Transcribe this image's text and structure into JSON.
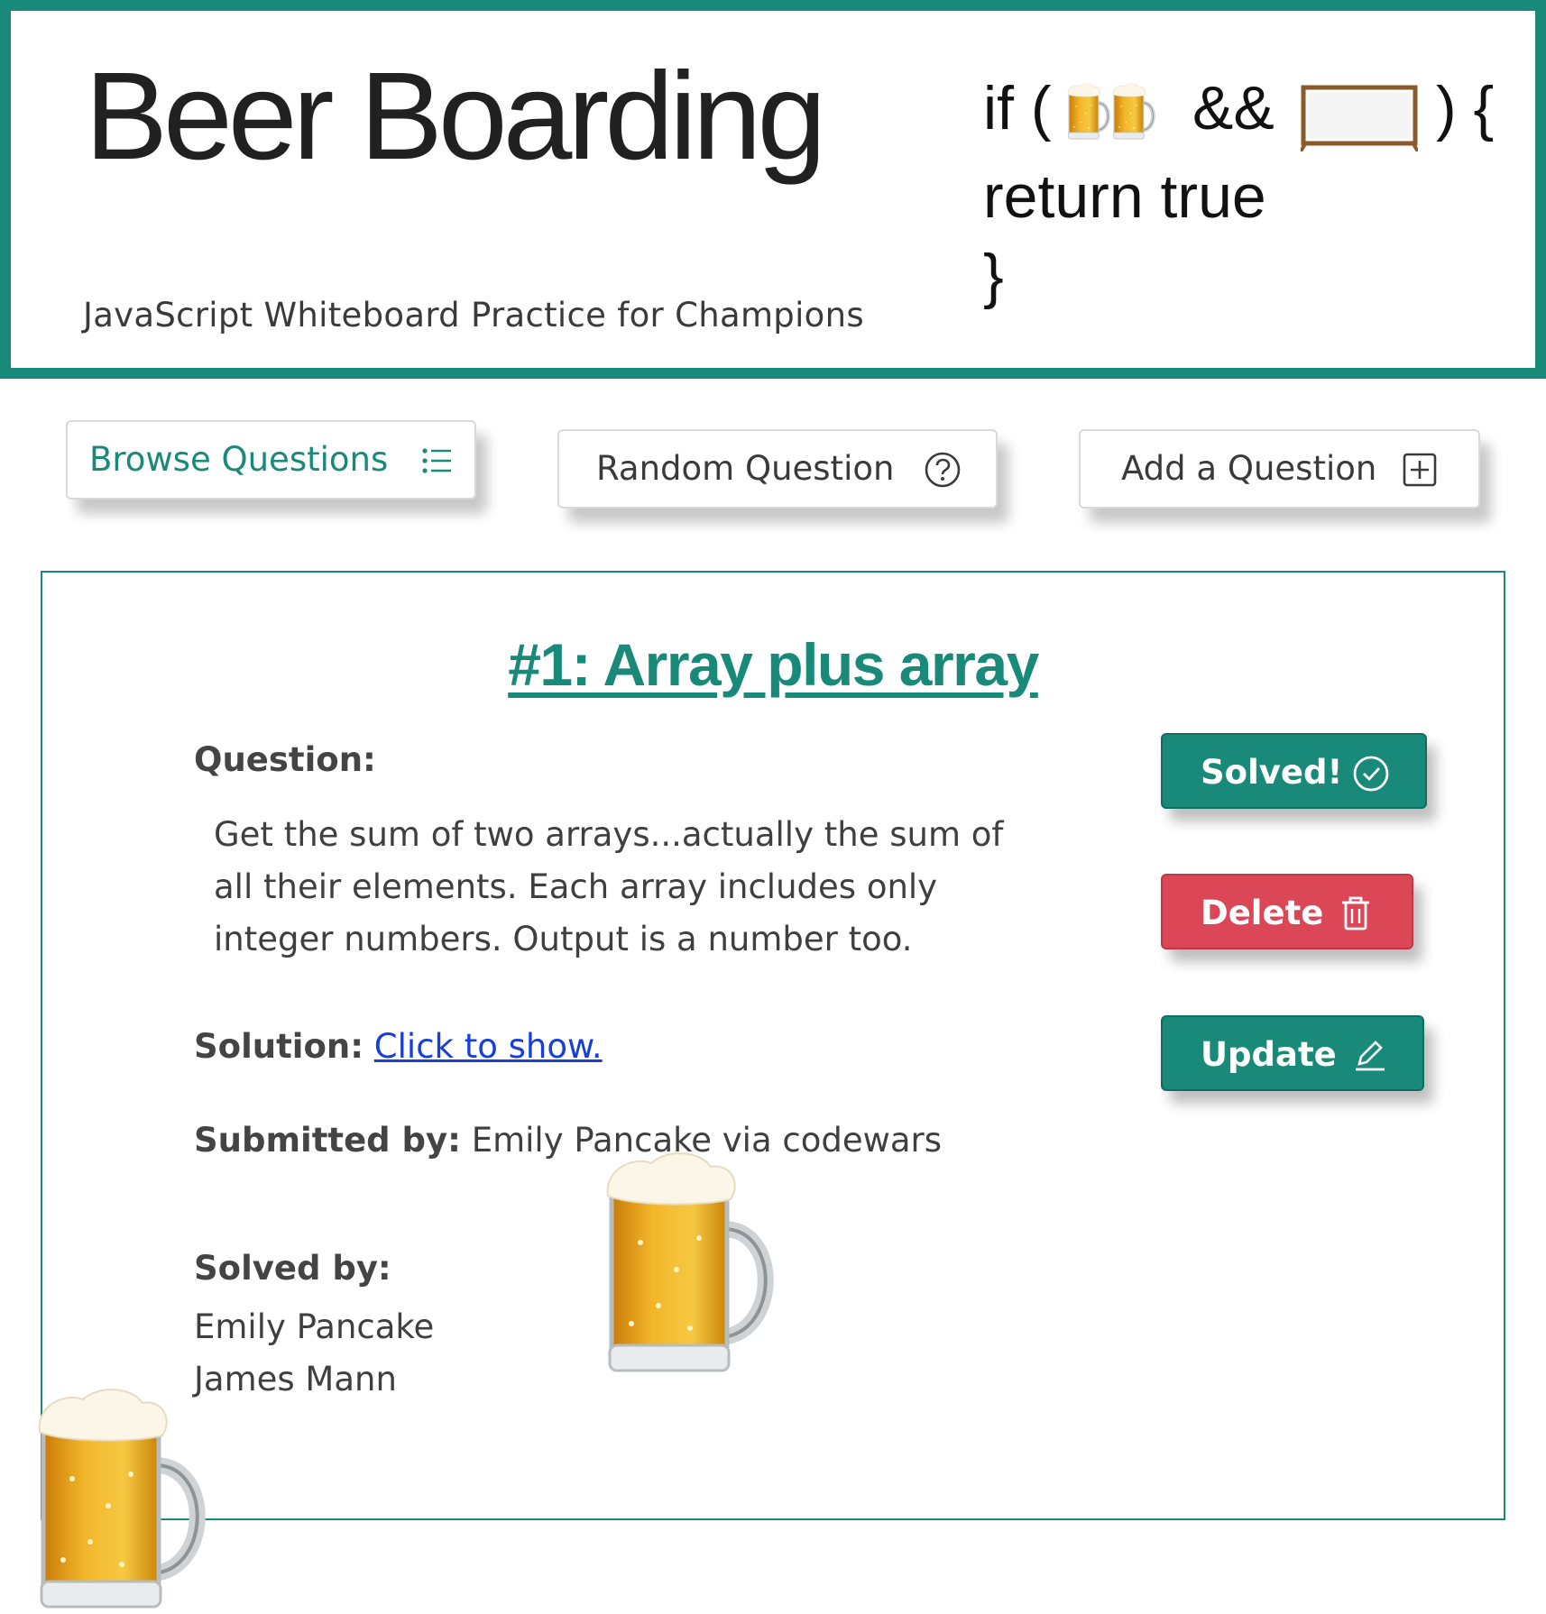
{
  "header": {
    "title": "Beer Boarding",
    "tagline": "JavaScript Whiteboard Practice for Champions",
    "logo": {
      "line1_if": "if (",
      "line1_and": "&&",
      "line1_close": ") {",
      "line2": "return true",
      "line3": "}",
      "icons": [
        "beer-mug-icon",
        "beer-mug-icon",
        "whiteboard-icon"
      ]
    }
  },
  "nav": {
    "browse": {
      "label": "Browse Questions",
      "icon": "list-icon",
      "active": true
    },
    "random": {
      "label": "Random Question",
      "icon": "question-circle-icon"
    },
    "add": {
      "label": "Add a Question",
      "icon": "plus-square-icon"
    }
  },
  "question": {
    "title": "#1: Array plus array",
    "question_label": "Question:",
    "question_text": "Get the sum of two arrays...actually the sum of all their elements. Each array includes only integer numbers. Output is a number too.",
    "solution_label": "Solution:",
    "solution_link": "Click to show.",
    "submitted_label": "Submitted by:",
    "submitted_value": "Emily Pancake via codewars",
    "solved_label": "Solved by:",
    "solvers": [
      "Emily Pancake",
      "James Mann"
    ]
  },
  "actions": {
    "solved": {
      "label": "Solved!",
      "icon": "check-circle-icon"
    },
    "delete": {
      "label": "Delete",
      "icon": "trash-icon"
    },
    "update": {
      "label": "Update",
      "icon": "pencil-icon"
    }
  },
  "colors": {
    "brand_teal": "#19897a",
    "danger_red": "#dc4757",
    "link_blue": "#1a3fd8",
    "beer_amber": "#e8a317"
  },
  "decorations": [
    "beer-mug-icon",
    "beer-mug-icon"
  ]
}
